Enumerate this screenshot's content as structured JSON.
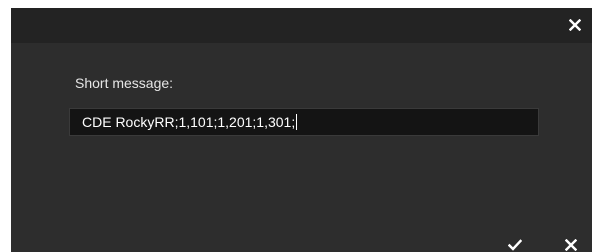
{
  "dialog": {
    "label": "Short message:",
    "input_value": "CDE RockyRR;1,101;1,201;1,301;"
  },
  "icons": {
    "title_close": "close-icon",
    "confirm": "checkmark-icon",
    "cancel": "close-icon"
  },
  "colors": {
    "dialog_bg": "#2d2d2d",
    "titlebar_bg": "#232323",
    "input_bg": "#141414",
    "text": "#e6e6e6"
  }
}
